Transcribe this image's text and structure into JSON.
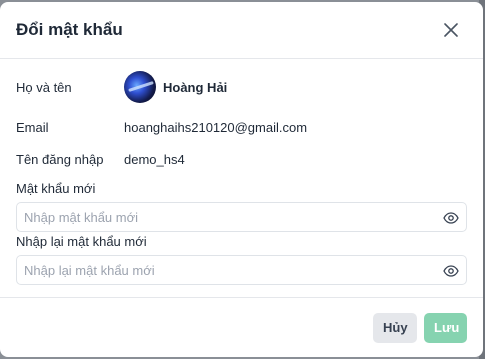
{
  "dialog": {
    "title": "Đổi mật khẩu"
  },
  "profile": {
    "name_label": "Họ và tên",
    "name_value": "Hoàng Hải",
    "email_label": "Email",
    "email_value": "hoanghaihs210120@gmail.com",
    "username_label": "Tên đăng nhập",
    "username_value": "demo_hs4"
  },
  "fields": {
    "new_password": {
      "label": "Mật khẩu mới",
      "placeholder": "Nhập mật khẩu mới",
      "value": ""
    },
    "confirm_password": {
      "label": "Nhập lại mật khẩu mới",
      "placeholder": "Nhập lại mật khẩu mới",
      "value": ""
    }
  },
  "footer": {
    "cancel_label": "Hủy",
    "save_label": "Lưu"
  },
  "colors": {
    "save_button_bg": "#86d3b0",
    "cancel_button_bg": "#e5e7eb"
  },
  "icons": {
    "close": "close-icon",
    "eye": "eye-icon"
  }
}
